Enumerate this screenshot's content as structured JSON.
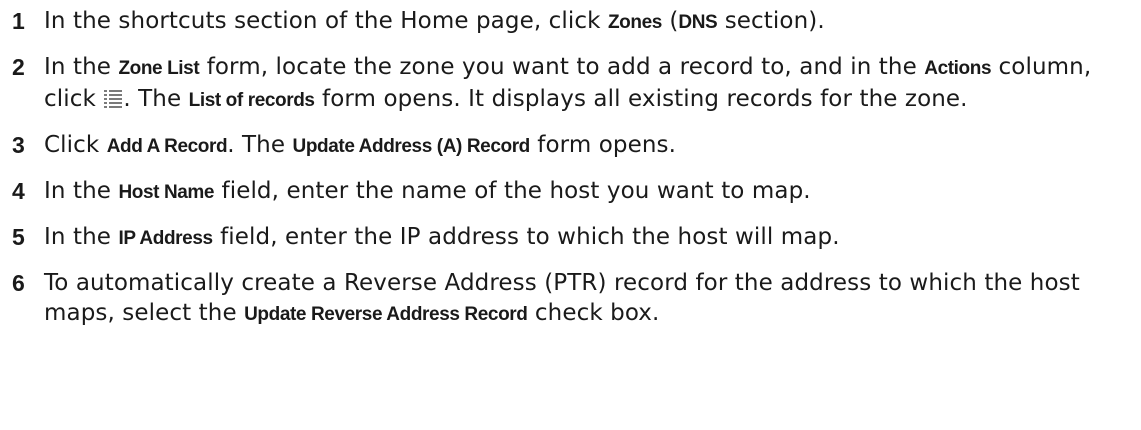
{
  "steps": [
    {
      "number": "1",
      "parts": [
        {
          "t": "In the shortcuts section of the Home page, click "
        },
        {
          "t": "Zones",
          "ui": true
        },
        {
          "t": " ("
        },
        {
          "t": "DNS",
          "ui": true
        },
        {
          "t": " section)."
        }
      ]
    },
    {
      "number": "2",
      "parts": [
        {
          "t": "In the "
        },
        {
          "t": "Zone List",
          "ui": true
        },
        {
          "t": " form, locate the zone you want to add a record to, and in the "
        },
        {
          "t": "Actions",
          "ui": true
        },
        {
          "t": " column, click "
        },
        {
          "icon": "list-icon"
        },
        {
          "t": ". The "
        },
        {
          "t": "List of records",
          "ui": true
        },
        {
          "t": " form opens. It displays all existing records for the zone."
        }
      ]
    },
    {
      "number": "3",
      "parts": [
        {
          "t": "Click "
        },
        {
          "t": "Add A Record",
          "ui": true
        },
        {
          "t": ". The "
        },
        {
          "t": "Update Address (A) Record",
          "ui": true
        },
        {
          "t": " form opens."
        }
      ]
    },
    {
      "number": "4",
      "parts": [
        {
          "t": "In the "
        },
        {
          "t": "Host Name",
          "ui": true
        },
        {
          "t": " field, enter the name of the host you want to map."
        }
      ]
    },
    {
      "number": "5",
      "parts": [
        {
          "t": "In the "
        },
        {
          "t": "IP Address",
          "ui": true
        },
        {
          "t": " field, enter the IP address to which the host will map."
        }
      ]
    },
    {
      "number": "6",
      "parts": [
        {
          "t": "To automatically create a Reverse Address (PTR) record for the address to which the host maps, select the "
        },
        {
          "t": "Update Reverse Address Record",
          "ui": true
        },
        {
          "t": " check box."
        }
      ]
    }
  ]
}
